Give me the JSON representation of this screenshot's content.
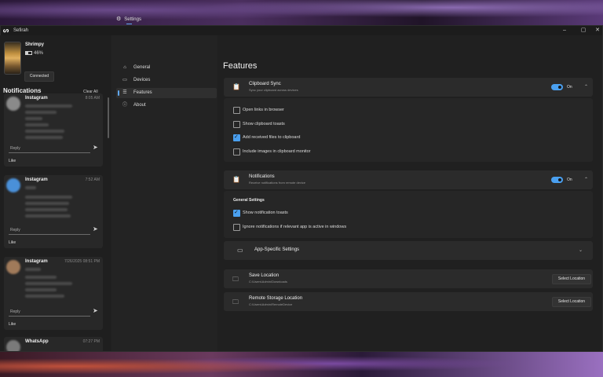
{
  "window": {
    "title": "Sefirah",
    "minimize": "–",
    "maximize": "▢",
    "close": "✕"
  },
  "device": {
    "name": "Shrimpy",
    "battery": "46%",
    "status": "Connected"
  },
  "notifications": {
    "heading": "Notifications",
    "clear_all": "Clear All",
    "reply_placeholder": "Reply",
    "like": "Like",
    "items": [
      {
        "app": "Instagram",
        "time": "8:05 AM"
      },
      {
        "app": "Instagram",
        "time": "7:52 AM"
      },
      {
        "app": "Instagram",
        "time": "7/26/2025 08:51 PM"
      },
      {
        "app": "WhatsApp",
        "time": "07:27 PM"
      }
    ]
  },
  "settings_tab": "Settings",
  "nav": [
    {
      "label": "General",
      "icon": "house-icon"
    },
    {
      "label": "Devices",
      "icon": "devices-icon"
    },
    {
      "label": "Features",
      "icon": "list-icon"
    },
    {
      "label": "About",
      "icon": "info-icon"
    }
  ],
  "page_title": "Features",
  "clipboard": {
    "title": "Clipboard Sync",
    "subtitle": "Sync your clipboard across devices",
    "toggle_label": "On",
    "options": [
      {
        "label": "Open links in browser",
        "checked": false
      },
      {
        "label": "Show clipboard toasts",
        "checked": false
      },
      {
        "label": "Add received files to clipboard",
        "checked": true
      },
      {
        "label": "Include images in clipboard monitor",
        "checked": false
      }
    ]
  },
  "notif_feature": {
    "title": "Notifications",
    "subtitle": "Receive notifications from remote device",
    "toggle_label": "On",
    "general_heading": "General Settings",
    "options": [
      {
        "label": "Show notification toasts",
        "checked": true
      },
      {
        "label": "Ignore notifications if relevant app is active in windows",
        "checked": false
      }
    ],
    "app_specific": "App-Specific Settings"
  },
  "save_location": {
    "title": "Save Location",
    "path": "C:\\Users\\Admin\\Downloads",
    "button": "Select Location"
  },
  "remote_storage": {
    "title": "Remote Storage Location",
    "path": "C:\\Users\\Admin\\RemoteDevice",
    "button": "Select Location"
  },
  "colors": {
    "accent": "#4aa0f0",
    "window_bg": "#202020",
    "panel_bg": "#2b2b2b"
  }
}
